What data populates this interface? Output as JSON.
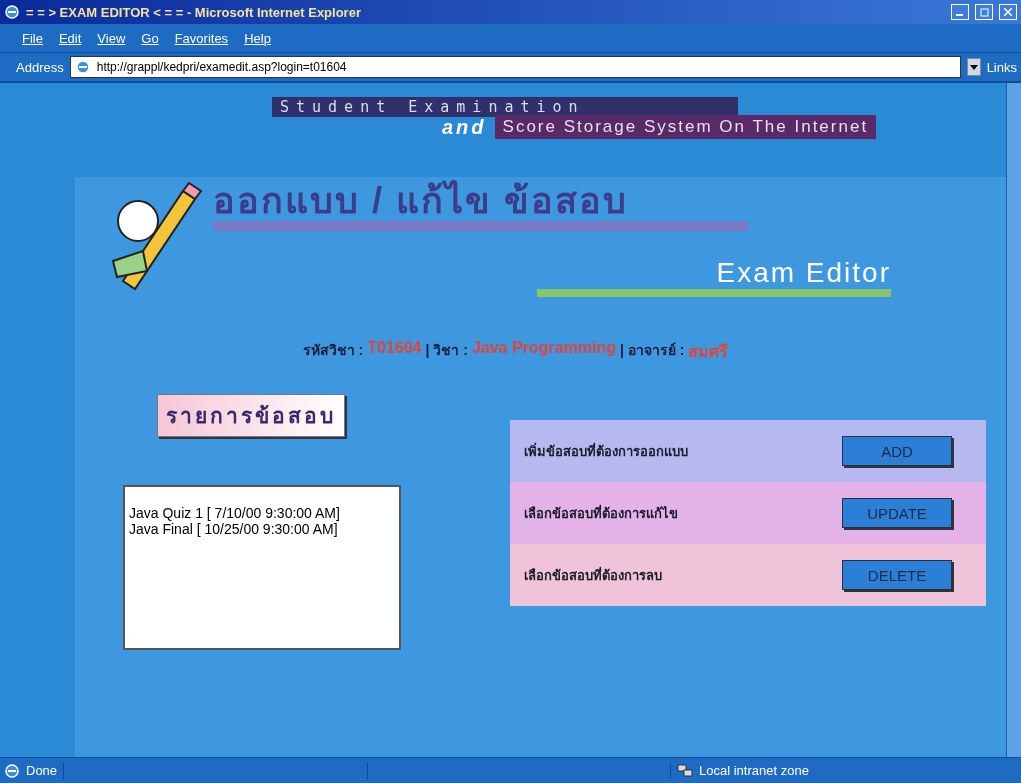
{
  "window": {
    "title": "= = > EXAM EDITOR < = = - Microsoft Internet Explorer"
  },
  "menu": [
    "File",
    "Edit",
    "View",
    "Go",
    "Favorites",
    "Help"
  ],
  "address_bar": {
    "label": "Address",
    "value": "http://grappl/kedpri/examedit.asp?login=t01604",
    "links": "Links"
  },
  "banner": {
    "line_1": "Student Examination",
    "and": "and",
    "line_2": "Score Storage System On The Internet"
  },
  "heading": {
    "thai": "ออกแบบ / แก้ไข ข้อสอบ",
    "english": "Exam Editor"
  },
  "info": [
    {
      "label": "รหัสวิชา :",
      "value": "T01604"
    },
    {
      "label": "| วิชา :",
      "value": "Java Programming"
    },
    {
      "label": "| อาจารย์ :",
      "value": "สมศรี"
    }
  ],
  "exam_list": {
    "title": "รายการข้อสอบ",
    "items": [
      {
        "label": "Java Quiz 1 [ 7/10/00 9:30:00 AM]",
        "selected": false
      },
      {
        "label": "Java Final [ 10/25/00 9:30:00 AM]",
        "selected": false
      }
    ]
  },
  "actions": [
    {
      "label": "เพิ่มข้อสอบที่ต้องการออกแบบ",
      "button": "ADD",
      "color": "#b6b8ef"
    },
    {
      "label": "เลือกข้อสอบที่ต้องการแก้ไข",
      "button": "UPDATE",
      "color": "#e3b2e6"
    },
    {
      "label": "เลือกข้อสอบที่ต้องการลบ",
      "button": "DELETE",
      "color": "#f0c4d8"
    }
  ],
  "status_bar": {
    "text": "Done",
    "zone": "Local intranet zone"
  }
}
